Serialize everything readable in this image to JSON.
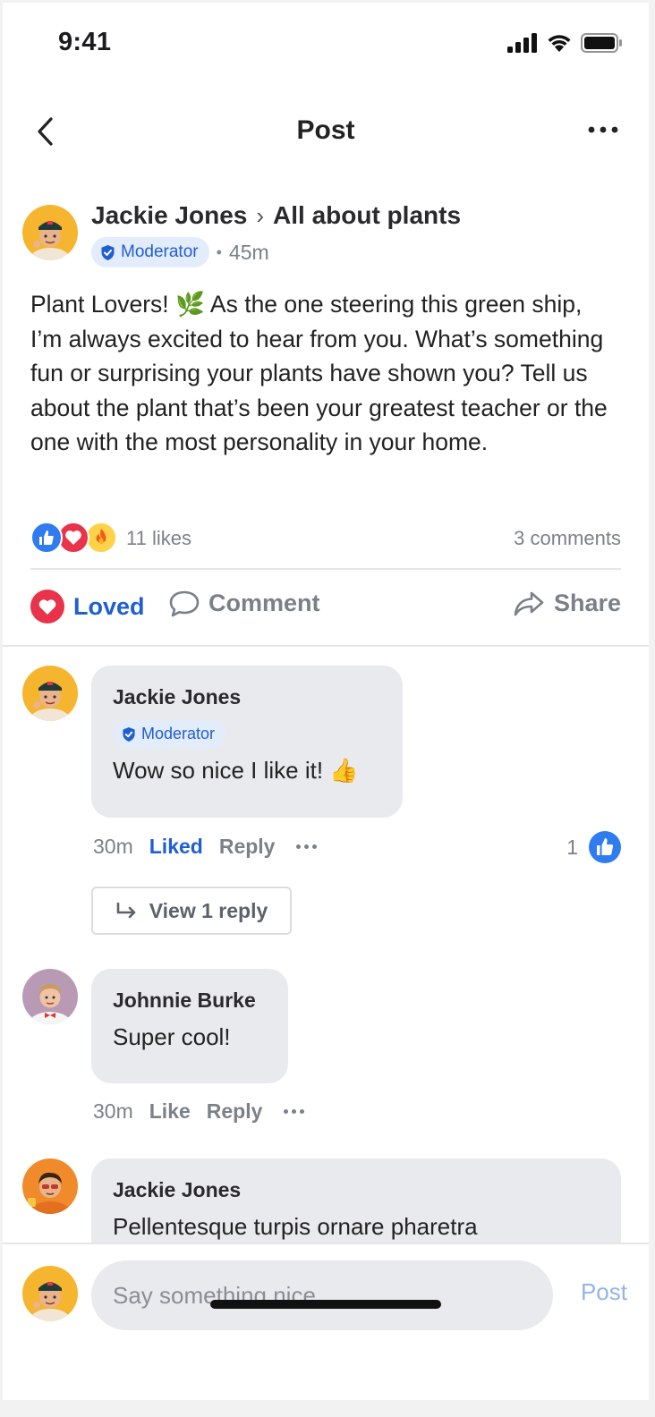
{
  "status_bar": {
    "time": "9:41"
  },
  "nav": {
    "title": "Post"
  },
  "post": {
    "author": "Jackie Jones",
    "group": "All about plants",
    "badge": "Moderator",
    "separator": "•",
    "age": "45m",
    "body": "Plant Lovers! 🌿 As the one steering this green ship, I’m always excited to hear from you. What’s something fun or surprising your plants have shown you? Tell us about the plant that’s been your greatest teacher or the one with the most personality in your home.",
    "likes_label": "11 likes",
    "comments_label": "3 comments",
    "actions": {
      "loved": "Loved",
      "comment": "Comment",
      "share": "Share"
    }
  },
  "comments": [
    {
      "author": "Jackie Jones",
      "badge": "Moderator",
      "text": "Wow so nice I like it! 👍",
      "age": "30m",
      "like_label": "Liked",
      "reply_label": "Reply",
      "like_count": "1",
      "view_replies": "View 1 reply"
    },
    {
      "author": "Johnnie Burke",
      "text": "Super cool!",
      "age": "30m",
      "like_label": "Like",
      "reply_label": "Reply"
    },
    {
      "author": "Jackie Jones",
      "text": "Pellentesque turpis ornare pharetra"
    }
  ],
  "composer": {
    "placeholder": "Say something nice...",
    "post_label": "Post"
  },
  "colors": {
    "accent": "#1f5fd1",
    "love": "#e8334a",
    "bubble": "#e9eaee",
    "muted": "#7c8089"
  }
}
